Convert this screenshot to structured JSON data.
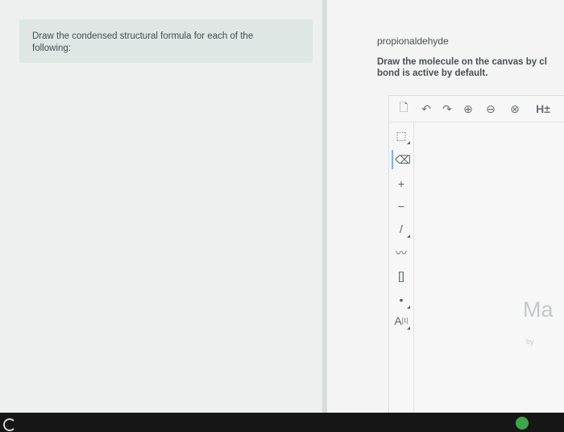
{
  "question": {
    "prompt": "Draw the condensed structural formula for each of the following:"
  },
  "task": {
    "molecule_name": "propionaldehyde",
    "instructions": "Draw the molecule on the canvas by cl",
    "instructions_line2": "bond is active by default."
  },
  "editor": {
    "top_tools": [
      {
        "name": "new-document-icon",
        "glyph": "🗋"
      },
      {
        "name": "undo-icon",
        "glyph": "↶"
      },
      {
        "name": "redo-icon",
        "glyph": "↷"
      },
      {
        "name": "zoom-in-icon",
        "glyph": "⊕"
      },
      {
        "name": "zoom-out-icon",
        "glyph": "⊖"
      },
      {
        "name": "zoom-reset-icon",
        "glyph": "⊗"
      },
      {
        "name": "hydrogen-toggle",
        "glyph": "H±"
      }
    ],
    "left_tools": [
      {
        "name": "selection-tool-icon",
        "glyph": "⬚"
      },
      {
        "name": "eraser-tool-icon",
        "glyph": "⌫"
      },
      {
        "name": "charge-plus-tool",
        "glyph": "+"
      },
      {
        "name": "charge-minus-tool",
        "glyph": "−"
      },
      {
        "name": "single-bond-tool",
        "glyph": "/"
      },
      {
        "name": "chain-tool-icon",
        "glyph": "〰"
      },
      {
        "name": "bracket-tool-icon",
        "glyph": "[]"
      },
      {
        "name": "electron-dot-tool",
        "glyph": "•"
      },
      {
        "name": "atom-label-tool",
        "glyph": "A"
      }
    ],
    "atom_label_superscript": "[1]",
    "watermark_text": "Ma",
    "watermark_by": "by"
  }
}
